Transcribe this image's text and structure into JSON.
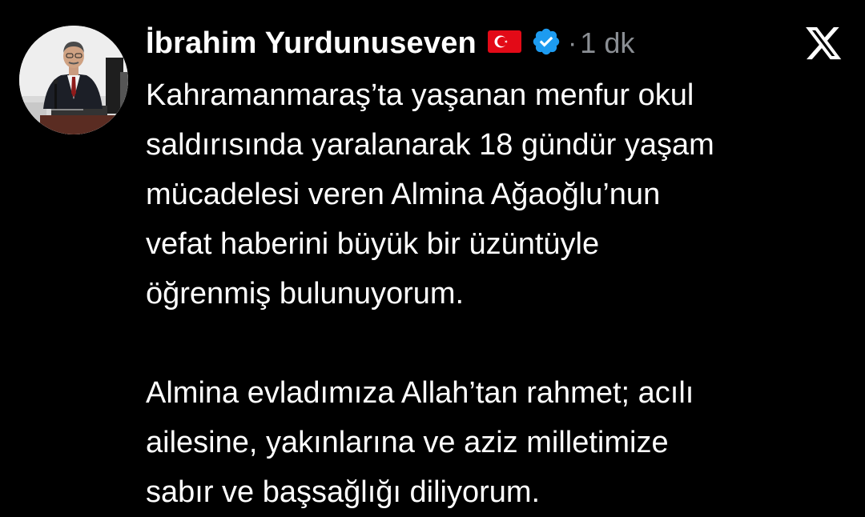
{
  "post": {
    "author": {
      "name": "İbrahim Yurdunuseven",
      "flag_icon": "turkey-flag-icon",
      "verified_icon": "verified-badge-icon"
    },
    "separator": "·",
    "time": "1 dk",
    "paragraph_1": [
      "Kahramanmaraş’ta yaşanan menfur okul",
      "saldırısında yaralanarak 18 gündür yaşam",
      "mücadelesi veren Almina Ağaoğlu’nun",
      "vefat haberini büyük bir üzüntüyle",
      "öğrenmiş bulunuyorum."
    ],
    "paragraph_2": [
      "Almina evladımıza Allah’tan rahmet; acılı",
      "ailesine, yakınlarına ve aziz milletimize",
      "sabır ve başsağlığı diliyorum."
    ]
  },
  "app": {
    "logo_icon": "x-logo-icon"
  },
  "colors": {
    "background": "#000000",
    "text": "#ffffff",
    "muted": "#8b8f94",
    "verified": "#1d9bf0",
    "flag_red": "#e30a17"
  }
}
